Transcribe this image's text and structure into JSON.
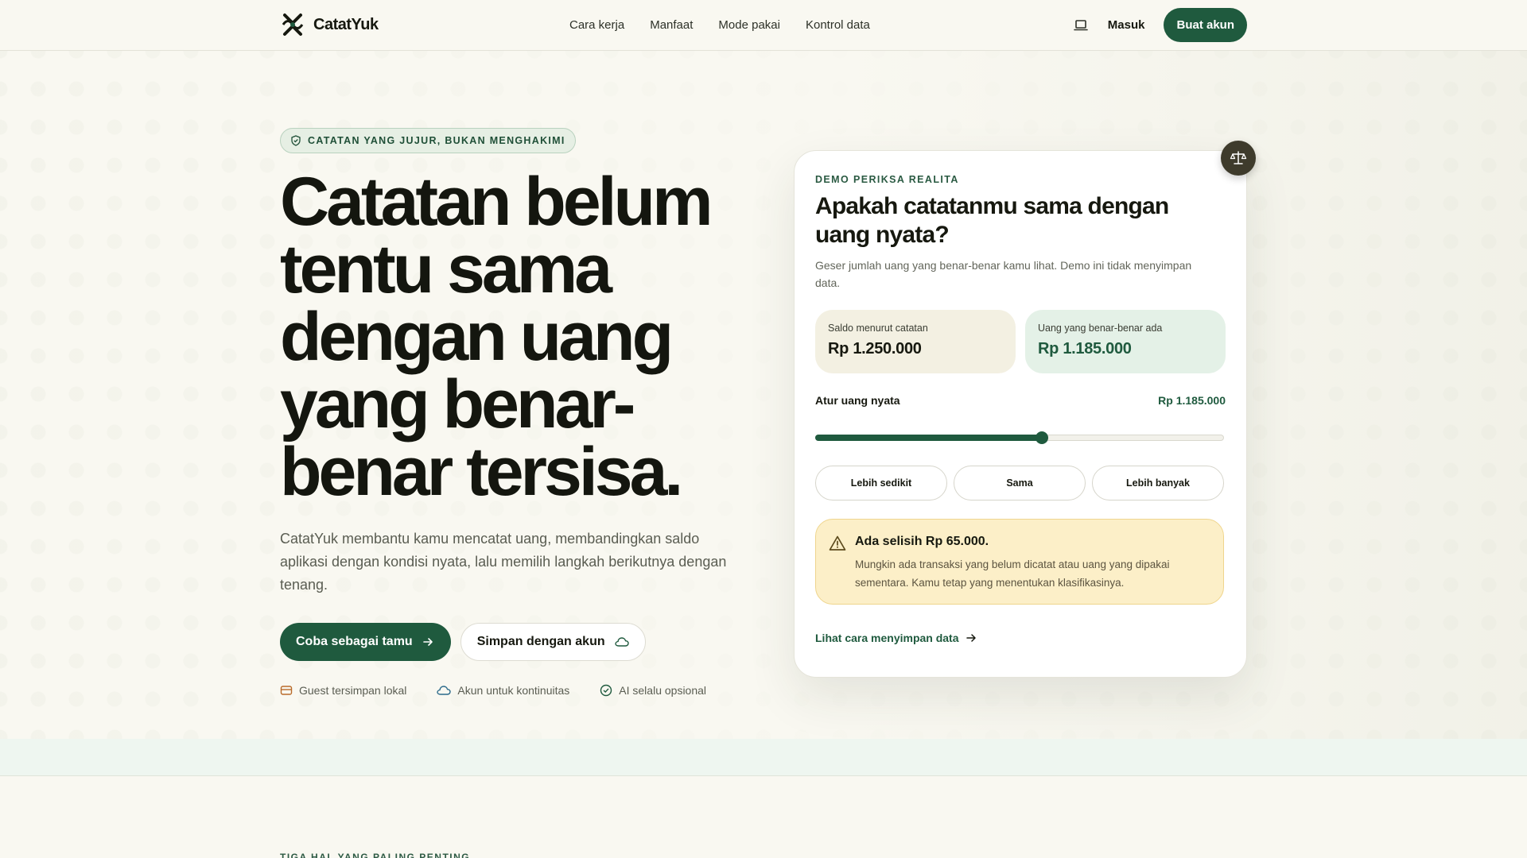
{
  "nav": {
    "brand": "CatatYuk",
    "links": [
      "Cara kerja",
      "Manfaat",
      "Mode pakai",
      "Kontrol data"
    ],
    "login": "Masuk",
    "cta": "Buat akun"
  },
  "hero": {
    "badge": "CATATAN YANG JUJUR, BUKAN MENGHAKIMI",
    "title": "Catatan belum tentu sama dengan uang yang benar-benar tersisa.",
    "subtitle": "CatatYuk membantu kamu mencatat uang, membandingkan saldo aplikasi dengan kondisi nyata, lalu memilih langkah berikutnya dengan tenang.",
    "primary_button": "Coba sebagai tamu",
    "secondary_button": "Simpan dengan akun",
    "features": [
      "Guest tersimpan lokal",
      "Akun untuk kontinuitas",
      "AI selalu opsional"
    ],
    "next_section_eyebrow": "TIGA HAL YANG PALING PENTING"
  },
  "demo": {
    "eyebrow": "DEMO PERIKSA REALITA",
    "title": "Apakah catatanmu sama dengan uang nyata?",
    "description": "Geser jumlah uang yang benar-benar kamu lihat. Demo ini tidak menyimpan data.",
    "balance_recorded_label": "Saldo menurut catatan",
    "balance_recorded_value": "Rp 1.250.000",
    "balance_actual_label": "Uang yang benar-benar ada",
    "balance_actual_value": "Rp 1.185.000",
    "slider_label": "Atur uang nyata",
    "slider_value": "Rp 1.185.000",
    "slider_position": 0.555,
    "choices": [
      "Lebih sedikit",
      "Sama",
      "Lebih banyak"
    ],
    "alert_title": "Ada selisih Rp 65.000.",
    "alert_body": "Mungkin ada transaksi yang belum dicatat atau uang yang dipakai sementara. Kamu tetap yang menentukan klasifikasinya.",
    "link": "Lihat cara menyimpan data"
  },
  "colors": {
    "brand_green": "#1f5a3e",
    "background": "#f9f8f1",
    "alert_bg": "#fcefc8"
  }
}
